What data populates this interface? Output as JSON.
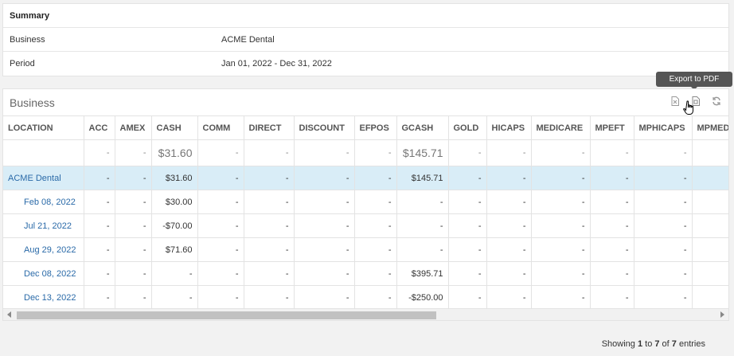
{
  "summary": {
    "title": "Summary",
    "rows": [
      {
        "label": "Business",
        "value": "ACME Dental"
      },
      {
        "label": "Period",
        "value": "Jan 01, 2022 - Dec 31, 2022"
      }
    ]
  },
  "business_panel": {
    "title": "Business",
    "tools": [
      {
        "icon": "excel-export-icon"
      },
      {
        "icon": "pdf-export-icon"
      },
      {
        "icon": "refresh-icon"
      }
    ],
    "tooltip": "Export to PDF"
  },
  "table": {
    "columns": [
      "LOCATION",
      "ACC",
      "AMEX",
      "CASH",
      "COMM",
      "DIRECT",
      "DISCOUNT",
      "EFPOS",
      "GCASH",
      "GOLD",
      "HICAPS",
      "MEDICARE",
      "MPEFT",
      "MPHICAPS",
      "MPMEDICARE"
    ],
    "totals": [
      "",
      "-",
      "-",
      "$31.60",
      "-",
      "-",
      "-",
      "-",
      "$145.71",
      "-",
      "-",
      "-",
      "-",
      "-",
      ""
    ],
    "rows": [
      {
        "type": "group",
        "cells": [
          "ACME Dental",
          "-",
          "-",
          "$31.60",
          "-",
          "-",
          "-",
          "-",
          "$145.71",
          "-",
          "-",
          "-",
          "-",
          "-",
          ""
        ]
      },
      {
        "type": "sub",
        "cells": [
          "Feb 08, 2022",
          "-",
          "-",
          "$30.00",
          "-",
          "-",
          "-",
          "-",
          "-",
          "-",
          "-",
          "-",
          "-",
          "-",
          ""
        ]
      },
      {
        "type": "sub",
        "cells": [
          "Jul 21, 2022",
          "-",
          "-",
          "-$70.00",
          "-",
          "-",
          "-",
          "-",
          "-",
          "-",
          "-",
          "-",
          "-",
          "-",
          ""
        ]
      },
      {
        "type": "sub",
        "cells": [
          "Aug 29, 2022",
          "-",
          "-",
          "$71.60",
          "-",
          "-",
          "-",
          "-",
          "-",
          "-",
          "-",
          "-",
          "-",
          "-",
          ""
        ]
      },
      {
        "type": "sub",
        "cells": [
          "Dec 08, 2022",
          "-",
          "-",
          "-",
          "-",
          "-",
          "-",
          "-",
          "$395.71",
          "-",
          "-",
          "-",
          "-",
          "-",
          ""
        ]
      },
      {
        "type": "sub",
        "cells": [
          "Dec 13, 2022",
          "-",
          "-",
          "-",
          "-",
          "-",
          "-",
          "-",
          "-$250.00",
          "-",
          "-",
          "-",
          "-",
          "-",
          ""
        ]
      }
    ]
  },
  "footer": {
    "prefix": "Showing ",
    "from": "1",
    "mid1": " to ",
    "to": "7",
    "mid2": " of ",
    "total": "7",
    "suffix": " entries"
  }
}
